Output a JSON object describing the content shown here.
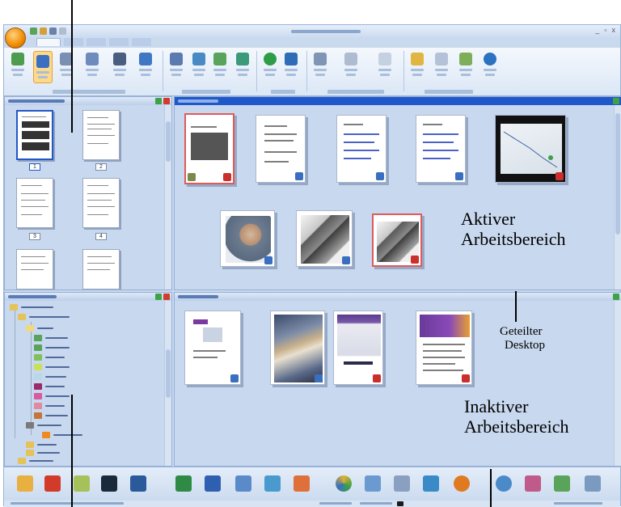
{
  "annotations": {
    "active_workspace": {
      "line1": "Aktiver",
      "line2": "Arbeitsbereich"
    },
    "split_desktop": {
      "line1": "Geteilter",
      "line2": "Desktop"
    },
    "inactive_workspace": {
      "line1": "Inaktiver",
      "line2": "Arbeitsbereich"
    }
  },
  "window": {
    "controls": {
      "minimize": "_",
      "maximize": "▫",
      "close": "x"
    }
  },
  "thumbnails": {
    "page_numbers": [
      "1",
      "2",
      "3",
      "4"
    ]
  },
  "colors": {
    "active_header": "#1f58c8",
    "pane_bg": "#c8d8ee",
    "selection": "#2458c6",
    "callout_text": "#000000"
  },
  "sendto_icons": [
    "paint-app-icon",
    "pdf-icon",
    "pencil-tool-icon",
    "camera-app-icon",
    "photoshop-icon",
    "excel-icon",
    "word-icon",
    "notepad-icon",
    "document-icon",
    "powerpoint-icon",
    "color-wheel-icon",
    "ftp-icon",
    "mail-icon",
    "magnifier-app-icon",
    "ocr-app-icon",
    "share-icon",
    "people-icon",
    "recycle-icon",
    "scanner-icon"
  ]
}
